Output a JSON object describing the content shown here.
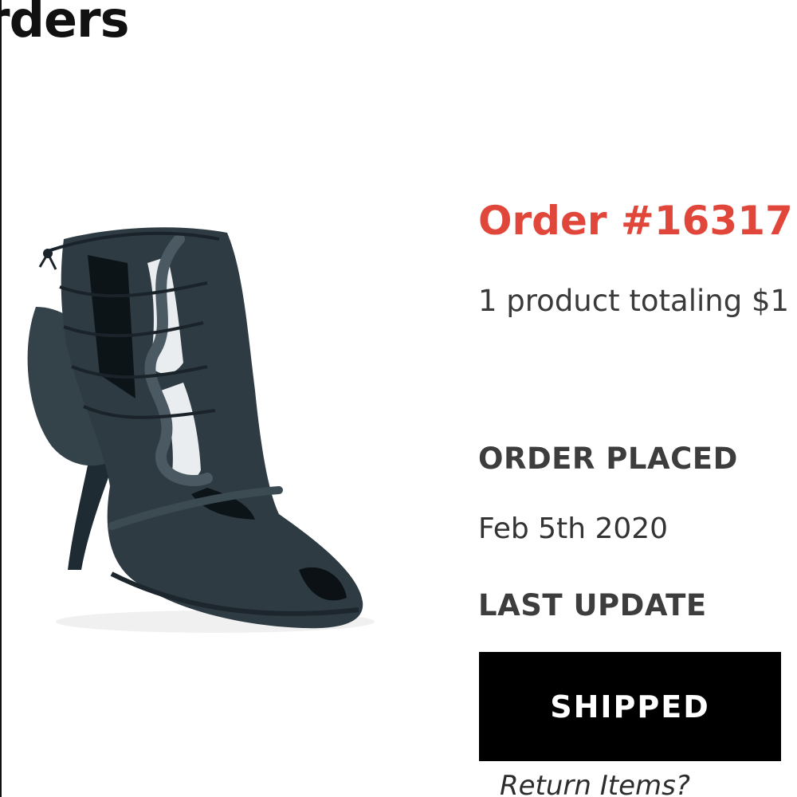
{
  "page": {
    "title": "rders"
  },
  "order": {
    "number_label": "Order #16317",
    "summary": "1 product totaling $1",
    "placed_label": "ORDER PLACED",
    "placed_date": "Feb 5th 2020",
    "update_label": "LAST UPDATE",
    "status": "SHIPPED",
    "return_link": "Return Items?"
  },
  "product": {
    "image_icon": "shoe-icon"
  },
  "colors": {
    "accent": "#e0473a",
    "text": "#333333",
    "button_bg": "#000000",
    "button_text": "#ffffff"
  }
}
